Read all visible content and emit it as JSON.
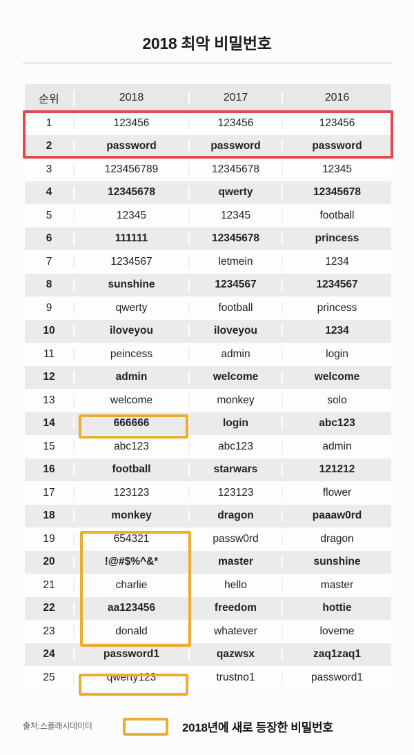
{
  "page": {
    "title": "2018 최악 비밀번호",
    "background_color": "#fcfcfc"
  },
  "colors": {
    "highlight_red": "#e8464a",
    "highlight_orange": "#edac2c",
    "header_bg": "#e8e8e8",
    "row_alt_bg": "#ebebeb"
  },
  "table": {
    "headers": {
      "rank": "순위",
      "y2018": "2018",
      "y2017": "2017",
      "y2016": "2016"
    },
    "rows": [
      {
        "rank": "1",
        "y2018": "123456",
        "y2017": "123456",
        "y2016": "123456"
      },
      {
        "rank": "2",
        "y2018": "password",
        "y2017": "password",
        "y2016": "password"
      },
      {
        "rank": "3",
        "y2018": "123456789",
        "y2017": "12345678",
        "y2016": "12345"
      },
      {
        "rank": "4",
        "y2018": "12345678",
        "y2017": "qwerty",
        "y2016": "12345678"
      },
      {
        "rank": "5",
        "y2018": "12345",
        "y2017": "12345",
        "y2016": "football"
      },
      {
        "rank": "6",
        "y2018": "111111",
        "y2017": "12345678",
        "y2016": "princess"
      },
      {
        "rank": "7",
        "y2018": "1234567",
        "y2017": "letmein",
        "y2016": "1234"
      },
      {
        "rank": "8",
        "y2018": "sunshine",
        "y2017": "1234567",
        "y2016": "1234567"
      },
      {
        "rank": "9",
        "y2018": "qwerty",
        "y2017": "football",
        "y2016": "princess"
      },
      {
        "rank": "10",
        "y2018": "iloveyou",
        "y2017": "iloveyou",
        "y2016": "1234"
      },
      {
        "rank": "11",
        "y2018": "peincess",
        "y2017": "admin",
        "y2016": "login"
      },
      {
        "rank": "12",
        "y2018": "admin",
        "y2017": "welcome",
        "y2016": "welcome"
      },
      {
        "rank": "13",
        "y2018": "welcome",
        "y2017": "monkey",
        "y2016": "solo"
      },
      {
        "rank": "14",
        "y2018": "666666",
        "y2017": "login",
        "y2016": "abc123"
      },
      {
        "rank": "15",
        "y2018": "abc123",
        "y2017": "abc123",
        "y2016": "admin"
      },
      {
        "rank": "16",
        "y2018": "football",
        "y2017": "starwars",
        "y2016": "121212"
      },
      {
        "rank": "17",
        "y2018": "123123",
        "y2017": "123123",
        "y2016": "flower"
      },
      {
        "rank": "18",
        "y2018": "monkey",
        "y2017": "dragon",
        "y2016": "paaaw0rd"
      },
      {
        "rank": "19",
        "y2018": "654321",
        "y2017": "passw0rd",
        "y2016": "dragon"
      },
      {
        "rank": "20",
        "y2018": "!@#$%^&*",
        "y2017": "master",
        "y2016": "sunshine"
      },
      {
        "rank": "21",
        "y2018": "charlie",
        "y2017": "hello",
        "y2016": "master"
      },
      {
        "rank": "22",
        "y2018": "aa123456",
        "y2017": "freedom",
        "y2016": "hottie"
      },
      {
        "rank": "23",
        "y2018": "donald",
        "y2017": "whatever",
        "y2016": "loveme"
      },
      {
        "rank": "24",
        "y2018": "password1",
        "y2017": "qazwsx",
        "y2016": "zaq1zaq1"
      },
      {
        "rank": "25",
        "y2018": "qwerty123",
        "y2017": "trustno1",
        "y2016": "password1"
      }
    ]
  },
  "footer": {
    "source": "출처:스플래시데이터",
    "legend_label": "2018년에 새로 등장한 비밀번호"
  }
}
